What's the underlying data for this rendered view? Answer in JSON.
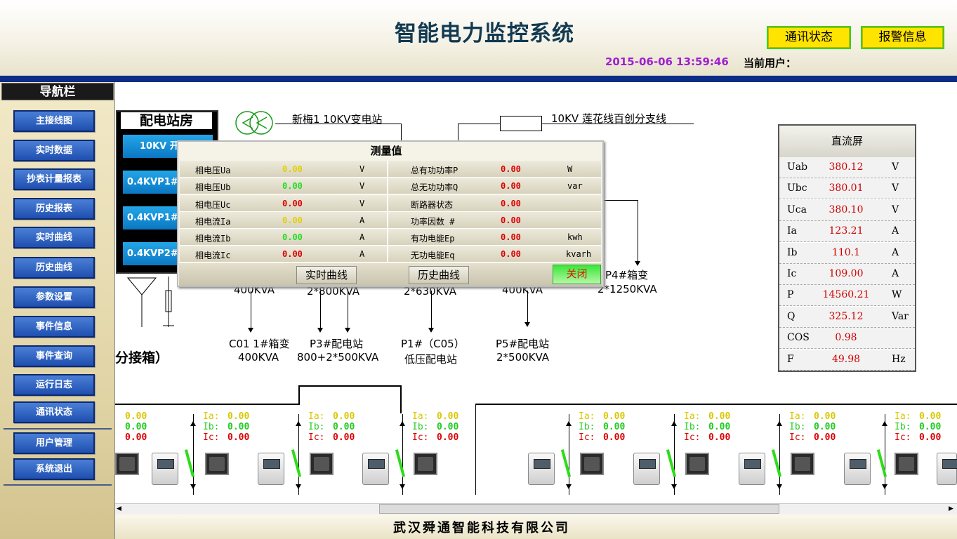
{
  "header": {
    "title": "智能电力监控系统",
    "comm_button": "通讯状态",
    "alarm_button": "报警信息",
    "datetime": "2015-06-06 13:59:46",
    "user_label": "当前用户："
  },
  "sidebar": {
    "title": "导航栏",
    "items": [
      {
        "label": "主接线图"
      },
      {
        "label": "实时数据"
      },
      {
        "label": "抄表计量报表"
      },
      {
        "label": "历史报表"
      },
      {
        "label": "实时曲线"
      },
      {
        "label": "历史曲线"
      },
      {
        "label": "参数设置"
      },
      {
        "label": "事件信息"
      },
      {
        "label": "事件查询"
      },
      {
        "label": "运行日志"
      },
      {
        "label": "通讯状态"
      },
      {
        "label": "用户管理"
      },
      {
        "label": "系统退出"
      }
    ]
  },
  "diagram": {
    "source1": "新梅1 10KV变电站",
    "source2": "10KV 莲花线百创分支线",
    "substation_title": "配电站房",
    "substation_buttons": [
      "10KV 开",
      "0.4KVP1#",
      "0.4KVP1#",
      "0.4KVP2#"
    ],
    "labels_row1": [
      "400KVA",
      "2*800KVA",
      "2*630KVA",
      "400KVA",
      "P4#箱变",
      "2*1250KVA"
    ],
    "loads": [
      {
        "name": "C01 1#箱变",
        "cap": "400KVA"
      },
      {
        "name": "P3#配电站",
        "cap": "800+2*500KVA"
      },
      {
        "name": "P1#（C05）",
        "cap": "低压配电站"
      },
      {
        "name": "P5#配电站",
        "cap": "2*500KVA"
      }
    ],
    "box_label": "分接箱）"
  },
  "popup": {
    "title": "测量值",
    "left_rows": [
      {
        "label": "相电压Ua",
        "value": "0.00",
        "unit": "V",
        "color": "#e0d000"
      },
      {
        "label": "相电压Ub",
        "value": "0.00",
        "unit": "V",
        "color": "#22dd22"
      },
      {
        "label": "相电压Uc",
        "value": "0.00",
        "unit": "V",
        "color": "#dd0000"
      },
      {
        "label": "相电流Ia",
        "value": "0.00",
        "unit": "A",
        "color": "#e0d000"
      },
      {
        "label": "相电流Ib",
        "value": "0.00",
        "unit": "A",
        "color": "#22dd22"
      },
      {
        "label": "相电流Ic",
        "value": "0.00",
        "unit": "A",
        "color": "#dd0000"
      }
    ],
    "right_rows": [
      {
        "label": "总有功功率P",
        "value": "0.00",
        "unit": "W"
      },
      {
        "label": "总无功功率Q",
        "value": "0.00",
        "unit": "var"
      },
      {
        "label": "断路器状态",
        "value": "0.00",
        "unit": ""
      },
      {
        "label": "功率因数 #",
        "value": "0.00",
        "unit": ""
      },
      {
        "label": "有功电能Ep",
        "value": "0.00",
        "unit": "kwh"
      },
      {
        "label": "无功电能Eq",
        "value": "0.00",
        "unit": "kvarh"
      }
    ],
    "btn_realtime": "实时曲线",
    "btn_history": "历史曲线",
    "btn_close": "关闭"
  },
  "dc_panel": {
    "title": "直流屏",
    "rows": [
      {
        "label": "Uab",
        "value": "380.12",
        "unit": "V"
      },
      {
        "label": "Ubc",
        "value": "380.01",
        "unit": "V"
      },
      {
        "label": "Uca",
        "value": "380.10",
        "unit": "V"
      },
      {
        "label": "Ia",
        "value": "123.21",
        "unit": "A"
      },
      {
        "label": "Ib",
        "value": "110.1",
        "unit": "A"
      },
      {
        "label": "Ic",
        "value": "109.00",
        "unit": "A"
      },
      {
        "label": "P",
        "value": "14560.21",
        "unit": "W"
      },
      {
        "label": "Q",
        "value": "325.12",
        "unit": "Var"
      },
      {
        "label": "COS",
        "value": "0.98",
        "unit": ""
      },
      {
        "label": "F",
        "value": "49.98",
        "unit": "Hz"
      }
    ]
  },
  "feeders": {
    "first": {
      "a": "0.00",
      "b": "0.00",
      "c": "0.00"
    },
    "items": [
      {
        "la": "Ia:",
        "lb": "Ib:",
        "lc": "Ic:",
        "a": "0.00",
        "b": "0.00",
        "c": "0.00"
      },
      {
        "la": "Ia:",
        "lb": "Ib:",
        "lc": "Ic:",
        "a": "0.00",
        "b": "0.00",
        "c": "0.00"
      },
      {
        "la": "Ia:",
        "lb": "Ib:",
        "lc": "Ic:",
        "a": "0.00",
        "b": "0.00",
        "c": "0.00"
      },
      {
        "la": "Ia:",
        "lb": "Ib:",
        "lc": "Ic:",
        "a": "0.00",
        "b": "0.00",
        "c": "0.00"
      },
      {
        "la": "Ia:",
        "lb": "Ib:",
        "lc": "Ic:",
        "a": "0.00",
        "b": "0.00",
        "c": "0.00"
      },
      {
        "la": "Ia:",
        "lb": "Ib:",
        "lc": "Ic:",
        "a": "0.00",
        "b": "0.00",
        "c": "0.00"
      },
      {
        "la": "Ia:",
        "lb": "Ib:",
        "lc": "Ic:",
        "a": "0.00",
        "b": "0.00",
        "c": "0.00"
      }
    ]
  },
  "colors": {
    "phase_a": "#d8c800",
    "phase_b": "#22cc22",
    "phase_c": "#dd0000"
  },
  "footer": {
    "company": "武汉舜通智能科技有限公司"
  }
}
